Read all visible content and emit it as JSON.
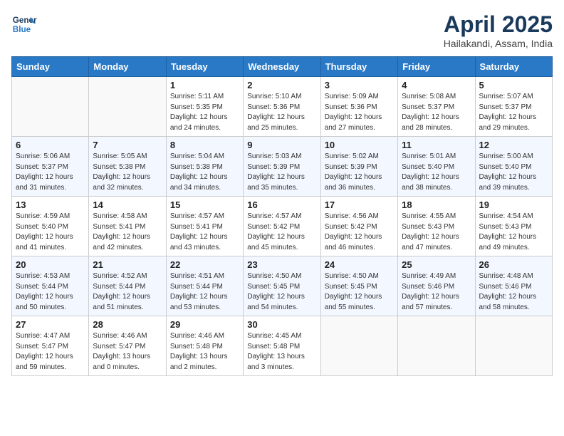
{
  "header": {
    "logo_line1": "General",
    "logo_line2": "Blue",
    "month": "April 2025",
    "location": "Hailakandi, Assam, India"
  },
  "columns": [
    "Sunday",
    "Monday",
    "Tuesday",
    "Wednesday",
    "Thursday",
    "Friday",
    "Saturday"
  ],
  "weeks": [
    [
      {
        "day": "",
        "info": ""
      },
      {
        "day": "",
        "info": ""
      },
      {
        "day": "1",
        "info": "Sunrise: 5:11 AM\nSunset: 5:35 PM\nDaylight: 12 hours\nand 24 minutes."
      },
      {
        "day": "2",
        "info": "Sunrise: 5:10 AM\nSunset: 5:36 PM\nDaylight: 12 hours\nand 25 minutes."
      },
      {
        "day": "3",
        "info": "Sunrise: 5:09 AM\nSunset: 5:36 PM\nDaylight: 12 hours\nand 27 minutes."
      },
      {
        "day": "4",
        "info": "Sunrise: 5:08 AM\nSunset: 5:37 PM\nDaylight: 12 hours\nand 28 minutes."
      },
      {
        "day": "5",
        "info": "Sunrise: 5:07 AM\nSunset: 5:37 PM\nDaylight: 12 hours\nand 29 minutes."
      }
    ],
    [
      {
        "day": "6",
        "info": "Sunrise: 5:06 AM\nSunset: 5:37 PM\nDaylight: 12 hours\nand 31 minutes."
      },
      {
        "day": "7",
        "info": "Sunrise: 5:05 AM\nSunset: 5:38 PM\nDaylight: 12 hours\nand 32 minutes."
      },
      {
        "day": "8",
        "info": "Sunrise: 5:04 AM\nSunset: 5:38 PM\nDaylight: 12 hours\nand 34 minutes."
      },
      {
        "day": "9",
        "info": "Sunrise: 5:03 AM\nSunset: 5:39 PM\nDaylight: 12 hours\nand 35 minutes."
      },
      {
        "day": "10",
        "info": "Sunrise: 5:02 AM\nSunset: 5:39 PM\nDaylight: 12 hours\nand 36 minutes."
      },
      {
        "day": "11",
        "info": "Sunrise: 5:01 AM\nSunset: 5:40 PM\nDaylight: 12 hours\nand 38 minutes."
      },
      {
        "day": "12",
        "info": "Sunrise: 5:00 AM\nSunset: 5:40 PM\nDaylight: 12 hours\nand 39 minutes."
      }
    ],
    [
      {
        "day": "13",
        "info": "Sunrise: 4:59 AM\nSunset: 5:40 PM\nDaylight: 12 hours\nand 41 minutes."
      },
      {
        "day": "14",
        "info": "Sunrise: 4:58 AM\nSunset: 5:41 PM\nDaylight: 12 hours\nand 42 minutes."
      },
      {
        "day": "15",
        "info": "Sunrise: 4:57 AM\nSunset: 5:41 PM\nDaylight: 12 hours\nand 43 minutes."
      },
      {
        "day": "16",
        "info": "Sunrise: 4:57 AM\nSunset: 5:42 PM\nDaylight: 12 hours\nand 45 minutes."
      },
      {
        "day": "17",
        "info": "Sunrise: 4:56 AM\nSunset: 5:42 PM\nDaylight: 12 hours\nand 46 minutes."
      },
      {
        "day": "18",
        "info": "Sunrise: 4:55 AM\nSunset: 5:43 PM\nDaylight: 12 hours\nand 47 minutes."
      },
      {
        "day": "19",
        "info": "Sunrise: 4:54 AM\nSunset: 5:43 PM\nDaylight: 12 hours\nand 49 minutes."
      }
    ],
    [
      {
        "day": "20",
        "info": "Sunrise: 4:53 AM\nSunset: 5:44 PM\nDaylight: 12 hours\nand 50 minutes."
      },
      {
        "day": "21",
        "info": "Sunrise: 4:52 AM\nSunset: 5:44 PM\nDaylight: 12 hours\nand 51 minutes."
      },
      {
        "day": "22",
        "info": "Sunrise: 4:51 AM\nSunset: 5:44 PM\nDaylight: 12 hours\nand 53 minutes."
      },
      {
        "day": "23",
        "info": "Sunrise: 4:50 AM\nSunset: 5:45 PM\nDaylight: 12 hours\nand 54 minutes."
      },
      {
        "day": "24",
        "info": "Sunrise: 4:50 AM\nSunset: 5:45 PM\nDaylight: 12 hours\nand 55 minutes."
      },
      {
        "day": "25",
        "info": "Sunrise: 4:49 AM\nSunset: 5:46 PM\nDaylight: 12 hours\nand 57 minutes."
      },
      {
        "day": "26",
        "info": "Sunrise: 4:48 AM\nSunset: 5:46 PM\nDaylight: 12 hours\nand 58 minutes."
      }
    ],
    [
      {
        "day": "27",
        "info": "Sunrise: 4:47 AM\nSunset: 5:47 PM\nDaylight: 12 hours\nand 59 minutes."
      },
      {
        "day": "28",
        "info": "Sunrise: 4:46 AM\nSunset: 5:47 PM\nDaylight: 13 hours\nand 0 minutes."
      },
      {
        "day": "29",
        "info": "Sunrise: 4:46 AM\nSunset: 5:48 PM\nDaylight: 13 hours\nand 2 minutes."
      },
      {
        "day": "30",
        "info": "Sunrise: 4:45 AM\nSunset: 5:48 PM\nDaylight: 13 hours\nand 3 minutes."
      },
      {
        "day": "",
        "info": ""
      },
      {
        "day": "",
        "info": ""
      },
      {
        "day": "",
        "info": ""
      }
    ]
  ]
}
